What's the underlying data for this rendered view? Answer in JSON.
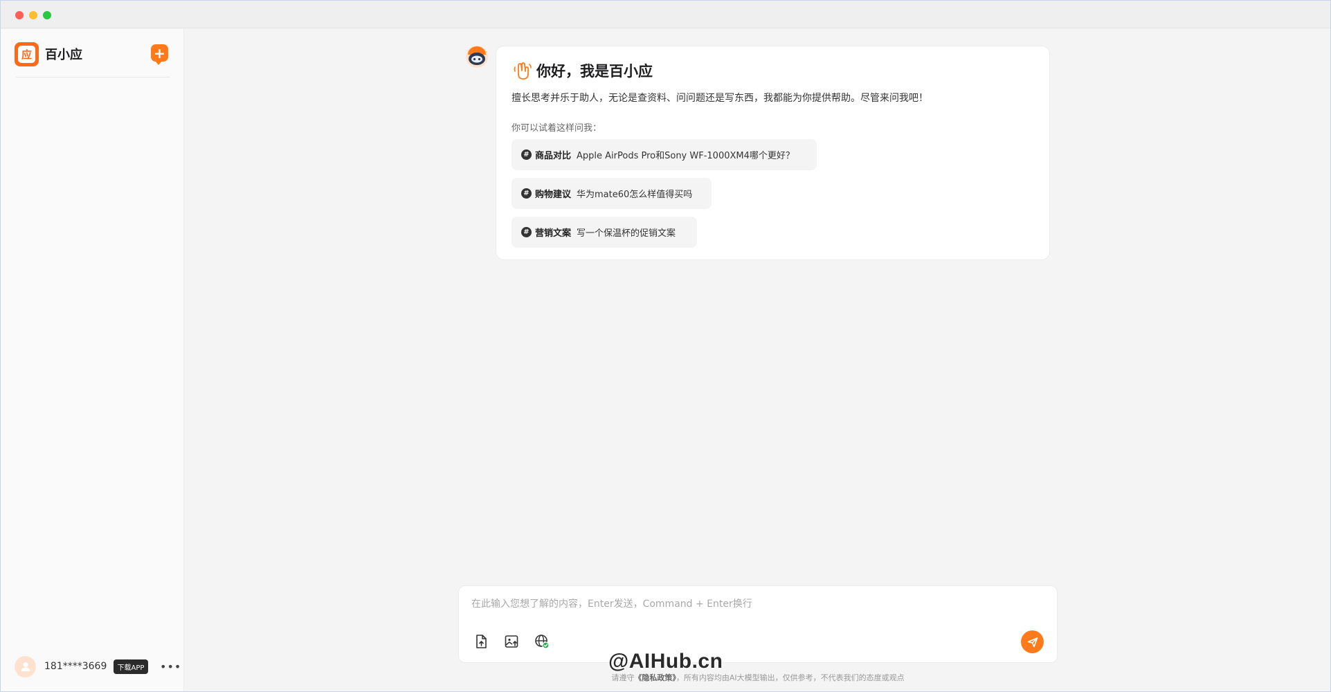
{
  "app": {
    "name": "百小应",
    "logo_char": "应"
  },
  "sidebar": {
    "user": {
      "phone": "181****3669",
      "download_badge": "下载APP",
      "more": "•••"
    }
  },
  "greeting": {
    "title": "你好，我是百小应",
    "description": "擅长思考并乐于助人，无论是查资料、问问题还是写东西，我都能为你提供帮助。尽管来问我吧！",
    "try_label": "你可以试着这样问我：",
    "suggestions": [
      {
        "category": "商品对比",
        "question": "Apple AirPods Pro和Sony WF-1000XM4哪个更好？"
      },
      {
        "category": "购物建议",
        "question": "华为mate60怎么样值得买吗"
      },
      {
        "category": "营销文案",
        "question": "写一个保温杯的促销文案"
      }
    ]
  },
  "composer": {
    "placeholder": "在此输入您想了解的内容，Enter发送，Command + Enter换行",
    "tools": [
      "file-upload-icon",
      "image-upload-icon",
      "web-search-icon"
    ],
    "send_icon": "send-icon"
  },
  "footer": {
    "prefix": "请遵守",
    "policy_link": "《隐私政策》",
    "suffix": "，所有内容均由AI大模型输出，仅供参考，不代表我们的态度或观点"
  },
  "watermark": "@AIHub.cn",
  "colors": {
    "accent": "#ff7a1a",
    "background": "#f4f4f5",
    "card": "#ffffff"
  }
}
